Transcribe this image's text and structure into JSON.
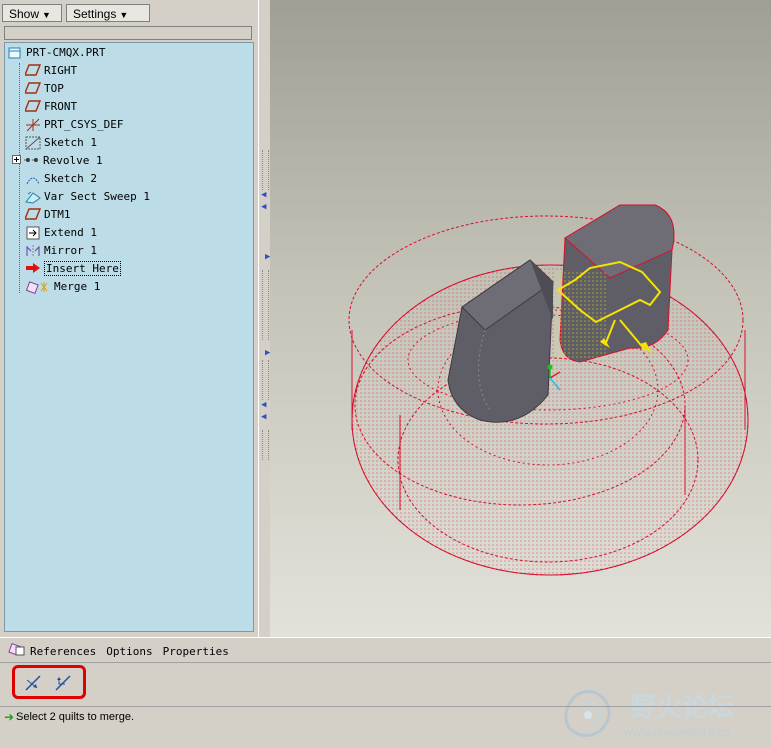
{
  "menu": {
    "show_label": "Show",
    "settings_label": "Settings"
  },
  "tree": {
    "root": "PRT-CMQX.PRT",
    "items": [
      {
        "label": "RIGHT",
        "icon": "datum-plane-icon"
      },
      {
        "label": "TOP",
        "icon": "datum-plane-icon"
      },
      {
        "label": "FRONT",
        "icon": "datum-plane-icon"
      },
      {
        "label": "PRT_CSYS_DEF",
        "icon": "csys-icon"
      },
      {
        "label": "Sketch 1",
        "icon": "sketch-icon"
      },
      {
        "label": "Revolve 1",
        "icon": "revolve-icon"
      },
      {
        "label": "Sketch 2",
        "icon": "sketch-icon"
      },
      {
        "label": "Var Sect Sweep 1",
        "icon": "sweep-icon"
      },
      {
        "label": "DTM1",
        "icon": "datum-plane-icon"
      },
      {
        "label": "Extend 1",
        "icon": "extend-icon"
      },
      {
        "label": "Mirror 1",
        "icon": "mirror-icon"
      },
      {
        "label": "Insert Here",
        "icon": "insert-arrow-icon"
      },
      {
        "label": "Merge 1",
        "icon": "merge-icon"
      }
    ]
  },
  "dashboard": {
    "tabs": [
      "References",
      "Options",
      "Properties"
    ],
    "status": "Select 2 quilts to merge."
  },
  "watermark": {
    "title": "野火论坛",
    "url": "www.proewildfire.cn"
  },
  "colors": {
    "tree_bg": "#bcdce7",
    "wire": "#d8102c",
    "solid": "#5f5e66",
    "highlight": "#ffee00"
  }
}
